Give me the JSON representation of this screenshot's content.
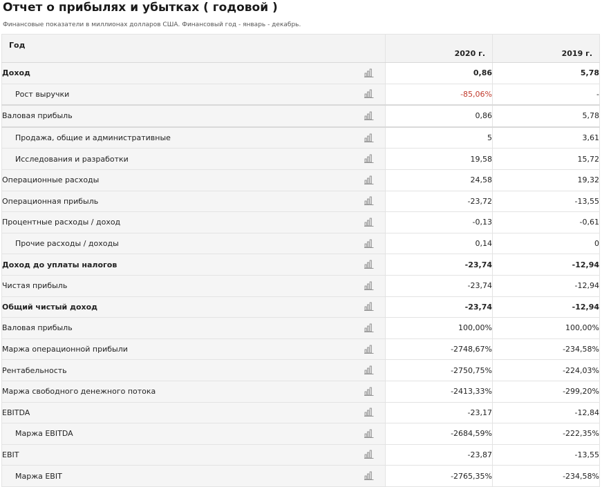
{
  "header": {
    "title": "Отчет о прибылях и убытках ( годовой )",
    "subtitle": "Финансовые показатели в миллионах долларов США. Финансовый год - январь - декабрь."
  },
  "table": {
    "columns": {
      "label": "Год",
      "year1": "2020 г.",
      "year2": "2019 г."
    },
    "rows": [
      {
        "label": "Доход",
        "bold": true,
        "indent": false,
        "v1": "0,86",
        "v2": "5,78"
      },
      {
        "label": "Рост выручки",
        "bold": false,
        "indent": true,
        "v1": "-85,06%",
        "v2": "-",
        "v1_color": "#c0392b"
      },
      {
        "label": "Валовая прибыль",
        "bold": false,
        "indent": false,
        "v1": "0,86",
        "v2": "5,78",
        "thick_top": true
      },
      {
        "label": "Продажа, общие и административные",
        "bold": false,
        "indent": true,
        "v1": "5",
        "v2": "3,61",
        "thick_top": true
      },
      {
        "label": "Исследования и разработки",
        "bold": false,
        "indent": true,
        "v1": "19,58",
        "v2": "15,72"
      },
      {
        "label": "Операционные расходы",
        "bold": false,
        "indent": false,
        "v1": "24,58",
        "v2": "19,32"
      },
      {
        "label": "Операционная прибыль",
        "bold": false,
        "indent": false,
        "v1": "-23,72",
        "v2": "-13,55"
      },
      {
        "label": "Процентные расходы / доход",
        "bold": false,
        "indent": false,
        "v1": "-0,13",
        "v2": "-0,61"
      },
      {
        "label": "Прочие расходы / доходы",
        "bold": false,
        "indent": true,
        "v1": "0,14",
        "v2": "0"
      },
      {
        "label": "Доход до уплаты налогов",
        "bold": true,
        "indent": false,
        "v1": "-23,74",
        "v2": "-12,94"
      },
      {
        "label": "Чистая прибыль",
        "bold": false,
        "indent": false,
        "v1": "-23,74",
        "v2": "-12,94"
      },
      {
        "label": "Общий чистый доход",
        "bold": true,
        "indent": false,
        "v1": "-23,74",
        "v2": "-12,94"
      },
      {
        "label": "Валовая прибыль",
        "bold": false,
        "indent": false,
        "v1": "100,00%",
        "v2": "100,00%"
      },
      {
        "label": "Маржа операционной прибыли",
        "bold": false,
        "indent": false,
        "v1": "-2748,67%",
        "v2": "-234,58%"
      },
      {
        "label": "Рентабельность",
        "bold": false,
        "indent": false,
        "v1": "-2750,75%",
        "v2": "-224,03%"
      },
      {
        "label": "Маржа свободного денежного потока",
        "bold": false,
        "indent": false,
        "v1": "-2413,33%",
        "v2": "-299,20%"
      },
      {
        "label": "EBITDA",
        "bold": false,
        "indent": false,
        "v1": "-23,17",
        "v2": "-12,84"
      },
      {
        "label": "Маржа EBITDA",
        "bold": false,
        "indent": true,
        "v1": "-2684,59%",
        "v2": "-222,35%"
      },
      {
        "label": "EBIT",
        "bold": false,
        "indent": false,
        "v1": "-23,87",
        "v2": "-13,55"
      },
      {
        "label": "Маржа EBIT",
        "bold": false,
        "indent": true,
        "v1": "-2765,35%",
        "v2": "-234,58%"
      }
    ]
  },
  "icons": {
    "row_chart": "bar-chart-icon"
  },
  "colors": {
    "negative_accent": "#c0392b",
    "label_bg": "#f5f5f5",
    "header_bg": "#f3f3f3",
    "border": "#e3e3e3"
  }
}
